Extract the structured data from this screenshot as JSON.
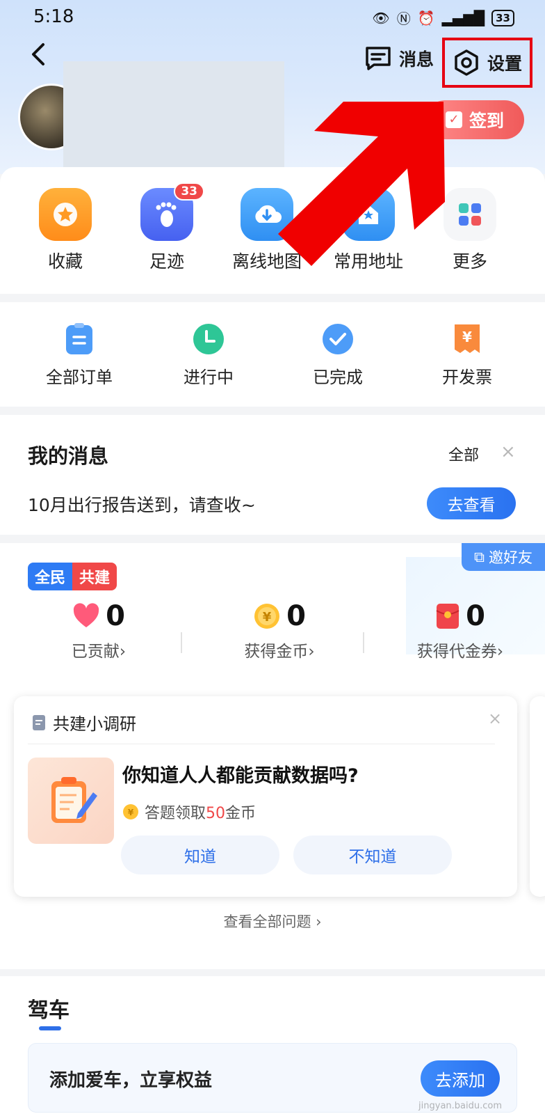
{
  "status_bar": {
    "time": "5:18",
    "battery": "33"
  },
  "header": {
    "messages_label": "消息",
    "settings_label": "设置",
    "checkin_label": "签到"
  },
  "colors": {
    "accent_blue": "#2e72f0",
    "highlight_red": "#e60012",
    "checkin_red": "#f05a5a"
  },
  "quick_actions": [
    {
      "label": "收藏",
      "icon": "star-icon"
    },
    {
      "label": "足迹",
      "icon": "footprint-icon",
      "badge": "33"
    },
    {
      "label": "离线地图",
      "icon": "cloud-download-icon"
    },
    {
      "label": "常用地址",
      "icon": "home-icon"
    },
    {
      "label": "更多",
      "icon": "grid-icon"
    }
  ],
  "orders": [
    {
      "label": "全部订单",
      "icon": "order-list-icon"
    },
    {
      "label": "进行中",
      "icon": "clock-icon"
    },
    {
      "label": "已完成",
      "icon": "check-icon"
    },
    {
      "label": "开发票",
      "icon": "invoice-icon"
    }
  ],
  "my_messages": {
    "title": "我的消息",
    "all_label": "全部",
    "close_icon": "×",
    "text": "10月出行报告送到，请查收~",
    "action": "去查看"
  },
  "co_build": {
    "tag_left": "全民",
    "tag_right": "共建",
    "invite_label": "邀好友",
    "stats": [
      {
        "value": "0",
        "label": "已贡献›",
        "icon": "heart-icon"
      },
      {
        "value": "0",
        "label": "获得金币›",
        "icon": "coin-icon"
      },
      {
        "value": "0",
        "label": "获得代金券›",
        "icon": "red-envelope-icon"
      }
    ],
    "survey": {
      "title": "共建小调研",
      "close_icon": "×",
      "question": "你知道人人都能贡献数据吗?",
      "reward_prefix": "答题领取",
      "reward_amount": "50",
      "reward_suffix": "金币",
      "answer_yes": "知道",
      "answer_no": "不知道"
    },
    "view_all": "查看全部问题 ›"
  },
  "driving": {
    "title": "驾车",
    "banner_text": "添加爱车，立享权益",
    "banner_button": "去添加"
  },
  "watermark": "jingyan.baidu.com"
}
